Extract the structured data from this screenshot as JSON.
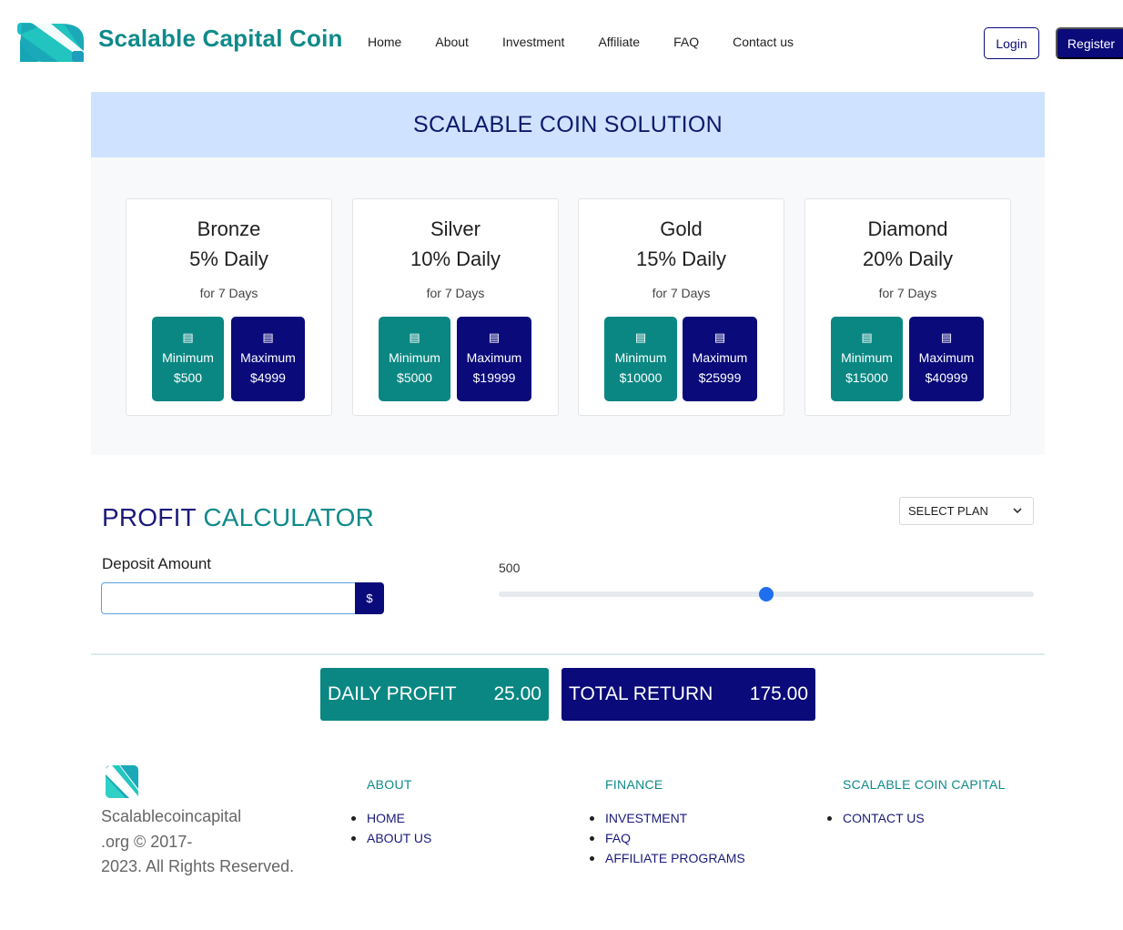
{
  "nav": {
    "brand": "Scalable Capital Coin",
    "links": [
      "Home",
      "About",
      "Investment",
      "Affiliate",
      "FAQ",
      "Contact us"
    ],
    "login": "Login",
    "register": "Register"
  },
  "hero": {
    "title": "SCALABLE COIN SOLUTION"
  },
  "plans": [
    {
      "name": "Bronze",
      "rate": "5% Daily",
      "duration": "for 7 Days",
      "min_label": "Minimum",
      "min_value": "$500",
      "max_label": "Maximum",
      "max_value": "$4999"
    },
    {
      "name": "Silver",
      "rate": "10% Daily",
      "duration": "for 7 Days",
      "min_label": "Minimum",
      "min_value": "$5000",
      "max_label": "Maximum",
      "max_value": "$19999"
    },
    {
      "name": "Gold",
      "rate": "15% Daily",
      "duration": "for 7 Days",
      "min_label": "Minimum",
      "min_value": "$10000",
      "max_label": "Maximum",
      "max_value": "$25999"
    },
    {
      "name": "Diamond",
      "rate": "20% Daily",
      "duration": "for 7 Days",
      "min_label": "Minimum",
      "min_value": "$15000",
      "max_label": "Maximum",
      "max_value": "$40999"
    }
  ],
  "calculator": {
    "title_part1": "PROFIT",
    "title_part2": "CALCULATOR",
    "select_plan": "SELECT PLAN",
    "deposit_label": "Deposit Amount",
    "deposit_value": "",
    "currency_addon": "$",
    "slider_value": "500",
    "slider_fraction": 0.5,
    "daily_label": "DAILY PROFIT",
    "daily_value": "25.00",
    "total_label": "TOTAL RETURN",
    "total_value": "175.00"
  },
  "footer": {
    "copyright_line1": "Scalablecoincapital",
    "copyright_line2": ".org © 2017-",
    "copyright_line3": "2023. All Rights Reserved.",
    "columns": [
      {
        "heading": "ABOUT",
        "items": [
          "HOME",
          "ABOUT US"
        ]
      },
      {
        "heading": "FINANCE",
        "items": [
          "INVESTMENT",
          "FAQ",
          "AFFILIATE PROGRAMS"
        ]
      },
      {
        "heading": "SCALABLE COIN CAPITAL",
        "items": [
          "CONTACT US"
        ]
      }
    ]
  },
  "colors": {
    "teal": "#0a8782",
    "navy": "#0a0a7a",
    "hero_bg": "#cfe2ff",
    "slider_thumb": "#1e6ff0"
  },
  "icons": {
    "logo": "scalable-s-logo",
    "plan_button": "cash-register-icon",
    "select_chevron": "chevron-down-icon"
  }
}
